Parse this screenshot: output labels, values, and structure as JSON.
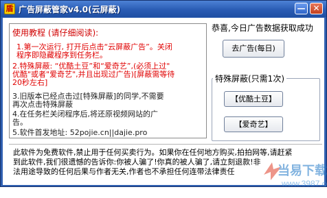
{
  "window": {
    "title": "广告屏蔽管家v4.0(云屏蔽)",
    "icon": "ad-shield-app-icon",
    "minimize_label": "—",
    "close_label": "✕"
  },
  "tutorial": {
    "title": "使用教程 (请仔细阅读):",
    "lines": [
      "1.第一次运行, 打开后点击“云屏蔽广告”。关闭",
      "程序即隐藏程序到任务栏。",
      "2.特殊屏蔽: “优酷土豆”和“爱奇艺”,(必须上过\"",
      "优酷\"或者\"爱奇艺\",并且出现过广告)[屏蔽需等待",
      "20秒左右]",
      "3.旧版本已经点击过[特殊屏蔽]的同学,不需要",
      "再次点击特殊屏蔽",
      "4.在任务栏关闭程序后,将还原视频网站的广",
      "告。",
      "5.软件首发地址: 52pojie.cn||dajie.pro"
    ]
  },
  "status": {
    "congrats": "恭喜,今日广告数据获取成功"
  },
  "buttons": {
    "daily_ads": "去广告(每日)",
    "special_group_label": "特殊屏蔽(只需1次)",
    "youku": "【优酷土豆】",
    "iqiyi": "【爱奇艺】"
  },
  "disclaimer": {
    "lines": [
      "此软件为免费软件,禁止用于任何买卖行为。如果你在任何地方购买,拍拍网等,请赶紧",
      "到此软件,我们很遗憾的告诉你:你被人骗了!你真的被人骗了,请立刻退款!非",
      "法用途导致的任何后果与作者无关,作者也不承担任何连带法律责任"
    ]
  },
  "watermark": {
    "text": "当易下载站",
    "url": "www.3987.com"
  },
  "colors": {
    "titlebar": "#2a5cb4",
    "tutorial_text": "#e00000"
  }
}
